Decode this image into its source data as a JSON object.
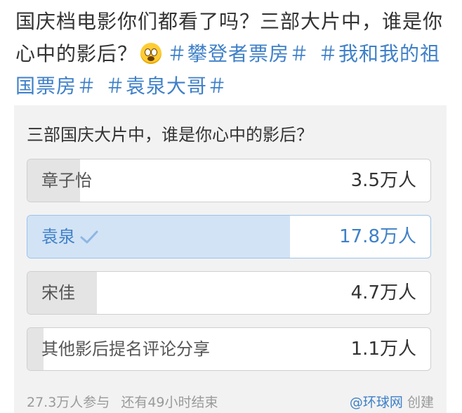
{
  "post": {
    "text": "国庆档电影你们都看了吗？三部大片中，谁是你心中的影后？",
    "emoji": "scared-face",
    "hashtags": [
      "＃攀登者票房＃",
      "＃我和我的祖国票房＃",
      "＃袁泉大哥＃"
    ]
  },
  "poll": {
    "question": "三部国庆大片中，谁是你心中的影后？",
    "options": [
      {
        "label": "章子怡",
        "count": "3.5万人",
        "share": 0.13,
        "selected": false
      },
      {
        "label": "袁泉",
        "count": "17.8万人",
        "share": 0.652,
        "selected": true
      },
      {
        "label": "宋佳",
        "count": "4.7万人",
        "share": 0.172,
        "selected": false
      },
      {
        "label": "其他影后提名评论分享",
        "count": "1.1万人",
        "share": 0.04,
        "selected": false
      }
    ],
    "participants": "27.3万人参与",
    "time_left": "还有49小时结束",
    "source_name": "@环球网",
    "source_suffix": "创建"
  },
  "colors": {
    "accent": "#3f80c8",
    "selected_fill": "#d2e3f5",
    "bar_fill": "#e4e4e4"
  }
}
